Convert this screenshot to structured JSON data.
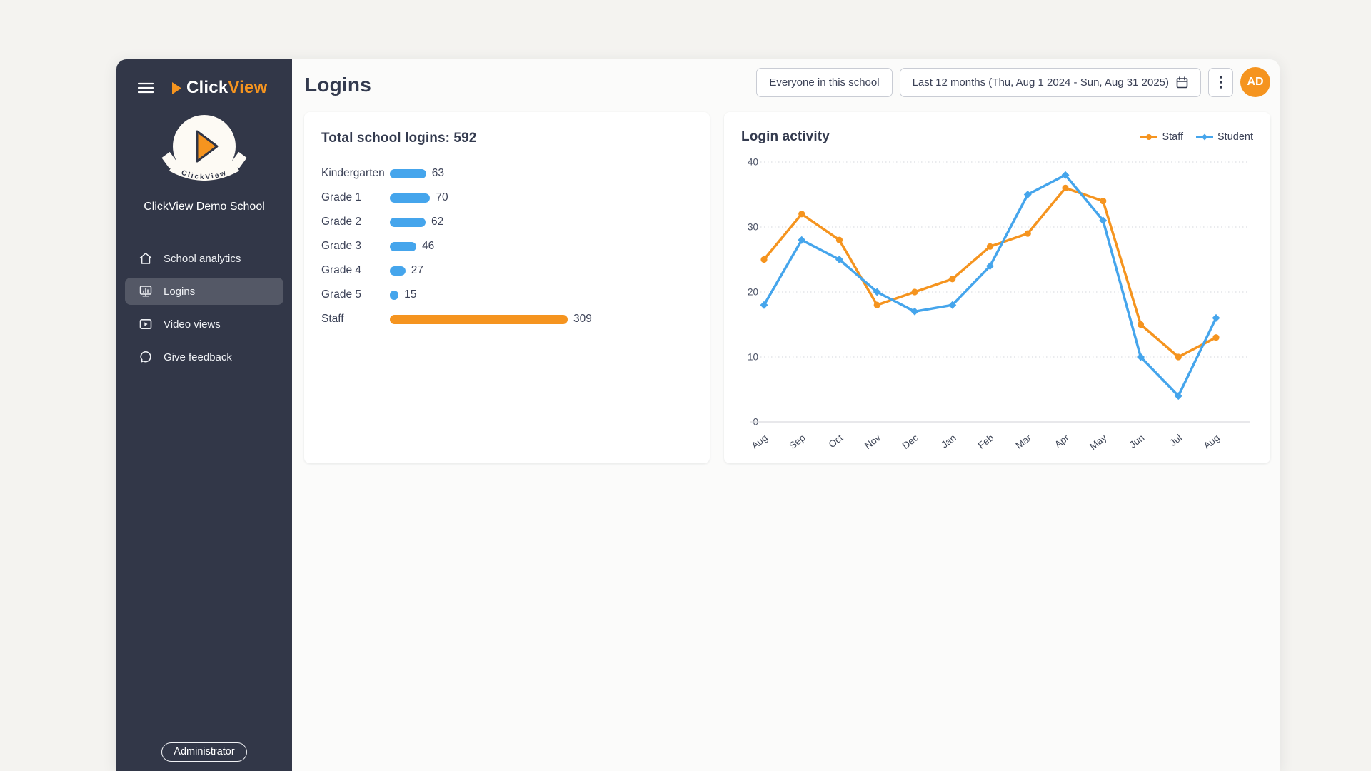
{
  "colors": {
    "brand_orange": "#f5941f",
    "series_blue": "#45a5ec",
    "sidebar_bg": "#323748",
    "text_dark": "#333a4e",
    "grid_gray": "#d5d7dc"
  },
  "sidebar": {
    "brand_click": "Click",
    "brand_view": "View",
    "emblem_text": "ClickView",
    "school_name": "ClickView Demo School",
    "items": [
      {
        "label": "School analytics",
        "icon": "home-icon",
        "active": false
      },
      {
        "label": "Logins",
        "icon": "logins-monitor-icon",
        "active": true
      },
      {
        "label": "Video views",
        "icon": "video-views-icon",
        "active": false
      },
      {
        "label": "Give feedback",
        "icon": "feedback-chat-icon",
        "active": false
      }
    ],
    "role_badge": "Administrator"
  },
  "header": {
    "page_title": "Logins",
    "audience_filter_label": "Everyone in this school",
    "date_range_label": "Last 12 months (Thu, Aug 1 2024 - Sun, Aug 31 2025)",
    "avatar_initials": "AD"
  },
  "chart_data": [
    {
      "type": "bar",
      "orientation": "horizontal",
      "title": "Total school logins: 592",
      "total": 592,
      "categories": [
        "Kindergarten",
        "Grade 1",
        "Grade 2",
        "Grade 3",
        "Grade 4",
        "Grade 5",
        "Staff"
      ],
      "values": [
        63,
        70,
        62,
        46,
        27,
        15,
        309
      ],
      "bar_colors": [
        "#45a5ec",
        "#45a5ec",
        "#45a5ec",
        "#45a5ec",
        "#45a5ec",
        "#45a5ec",
        "#f5941f"
      ],
      "xlim": [
        0,
        309
      ],
      "value_labels": true
    },
    {
      "type": "line",
      "title": "Login activity",
      "categories": [
        "Aug",
        "Sep",
        "Oct",
        "Nov",
        "Dec",
        "Jan",
        "Feb",
        "Mar",
        "Apr",
        "May",
        "Jun",
        "Jul",
        "Aug"
      ],
      "series": [
        {
          "name": "Staff",
          "color": "#f5941f",
          "marker": "circle",
          "values": [
            25,
            32,
            28,
            18,
            20,
            22,
            27,
            29,
            36,
            34,
            15,
            10,
            13
          ]
        },
        {
          "name": "Student",
          "color": "#45a5ec",
          "marker": "diamond",
          "values": [
            18,
            28,
            25,
            20,
            17,
            18,
            24,
            35,
            38,
            31,
            10,
            4,
            16
          ]
        }
      ],
      "ylim": [
        0,
        40
      ],
      "yticks": [
        0,
        10,
        20,
        30,
        40
      ],
      "grid": "dotted-horizontal",
      "legend_position": "top-right",
      "x_label_rotation": -38
    }
  ]
}
